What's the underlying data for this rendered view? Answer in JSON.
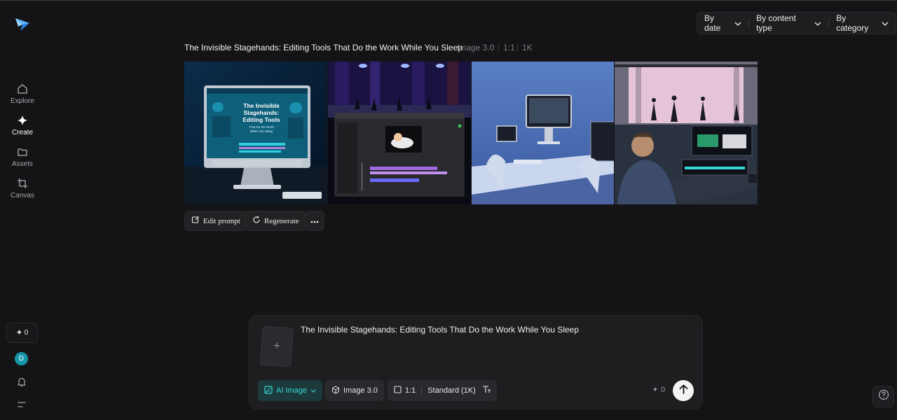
{
  "sidebar": {
    "items": [
      {
        "label": "Explore",
        "icon": "home-icon"
      },
      {
        "label": "Create",
        "icon": "sparkle-icon"
      },
      {
        "label": "Assets",
        "icon": "folder-icon"
      },
      {
        "label": "Canvas",
        "icon": "crop-icon"
      }
    ],
    "credits": "0",
    "avatar_initial": "D"
  },
  "filters": {
    "by_date": "By date",
    "by_content_type": "By content type",
    "by_category": "By category"
  },
  "result": {
    "title": "The Invisible Stagehands: Editing Tools That Do the Work While You Sleep",
    "model": "Image 3.0",
    "ratio": "1:1",
    "resolution": "1K",
    "image1_text": {
      "line1": "The Invisible",
      "line2": "Stagehands:",
      "line3": "Editing Tools",
      "line4": "That Do the Work",
      "line5": "While You Sleep"
    },
    "actions": {
      "edit_prompt": "Edit prompt",
      "regenerate": "Regenerate"
    }
  },
  "composer": {
    "prompt": "The Invisible Stagehands: Editing Tools That Do the Work While You Sleep",
    "mode": "AI Image",
    "model": "Image 3.0",
    "ratio": "1:1",
    "quality": "Standard (1K)",
    "cost": "0"
  },
  "colors": {
    "accent": "#36d6d4",
    "background": "#141416",
    "avatar": "#1596a6"
  }
}
